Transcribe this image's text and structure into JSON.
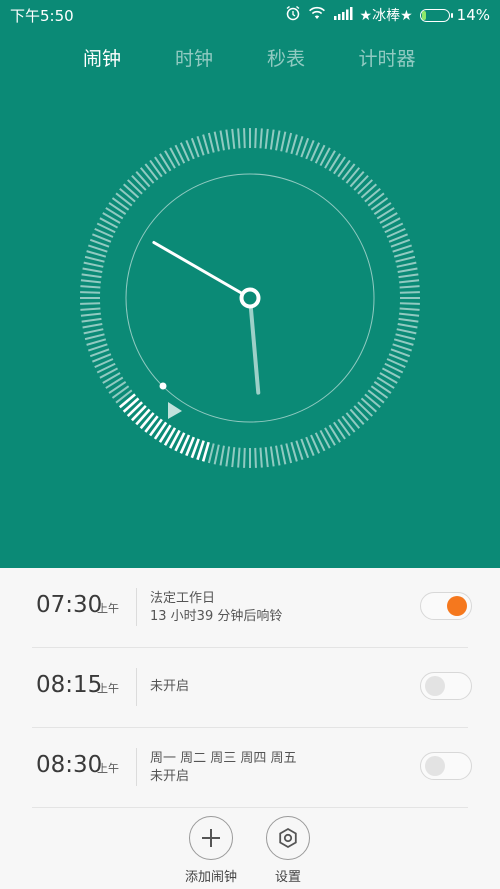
{
  "status_bar": {
    "time": "下午5:50",
    "carrier": "★冰棒★",
    "battery_percent": "14%",
    "battery_level": 0.14,
    "icons": [
      "alarm-icon",
      "wifi-icon",
      "signal-icon",
      "battery-icon"
    ]
  },
  "tabs": [
    {
      "label": "闹钟",
      "active": true
    },
    {
      "label": "时钟",
      "active": false
    },
    {
      "label": "秒表",
      "active": false
    },
    {
      "label": "计时器",
      "active": false
    }
  ],
  "clock": {
    "hour": 5,
    "minute": 50,
    "dial_color": "#ffffff",
    "background": "#0b8a76"
  },
  "alarms": [
    {
      "time": "07:30",
      "ampm": "上午",
      "line1": "法定工作日",
      "line2": "13 小时39 分钟后响铃",
      "enabled": true
    },
    {
      "time": "08:15",
      "ampm": "上午",
      "line1": "未开启",
      "line2": "",
      "enabled": false
    },
    {
      "time": "08:30",
      "ampm": "上午",
      "line1": "周一 周二 周三 周四 周五",
      "line2": "未开启",
      "enabled": false
    }
  ],
  "actions": {
    "add_label": "添加闹钟",
    "settings_label": "设置"
  },
  "colors": {
    "accent": "#f5781e",
    "header": "#0b8a76"
  }
}
